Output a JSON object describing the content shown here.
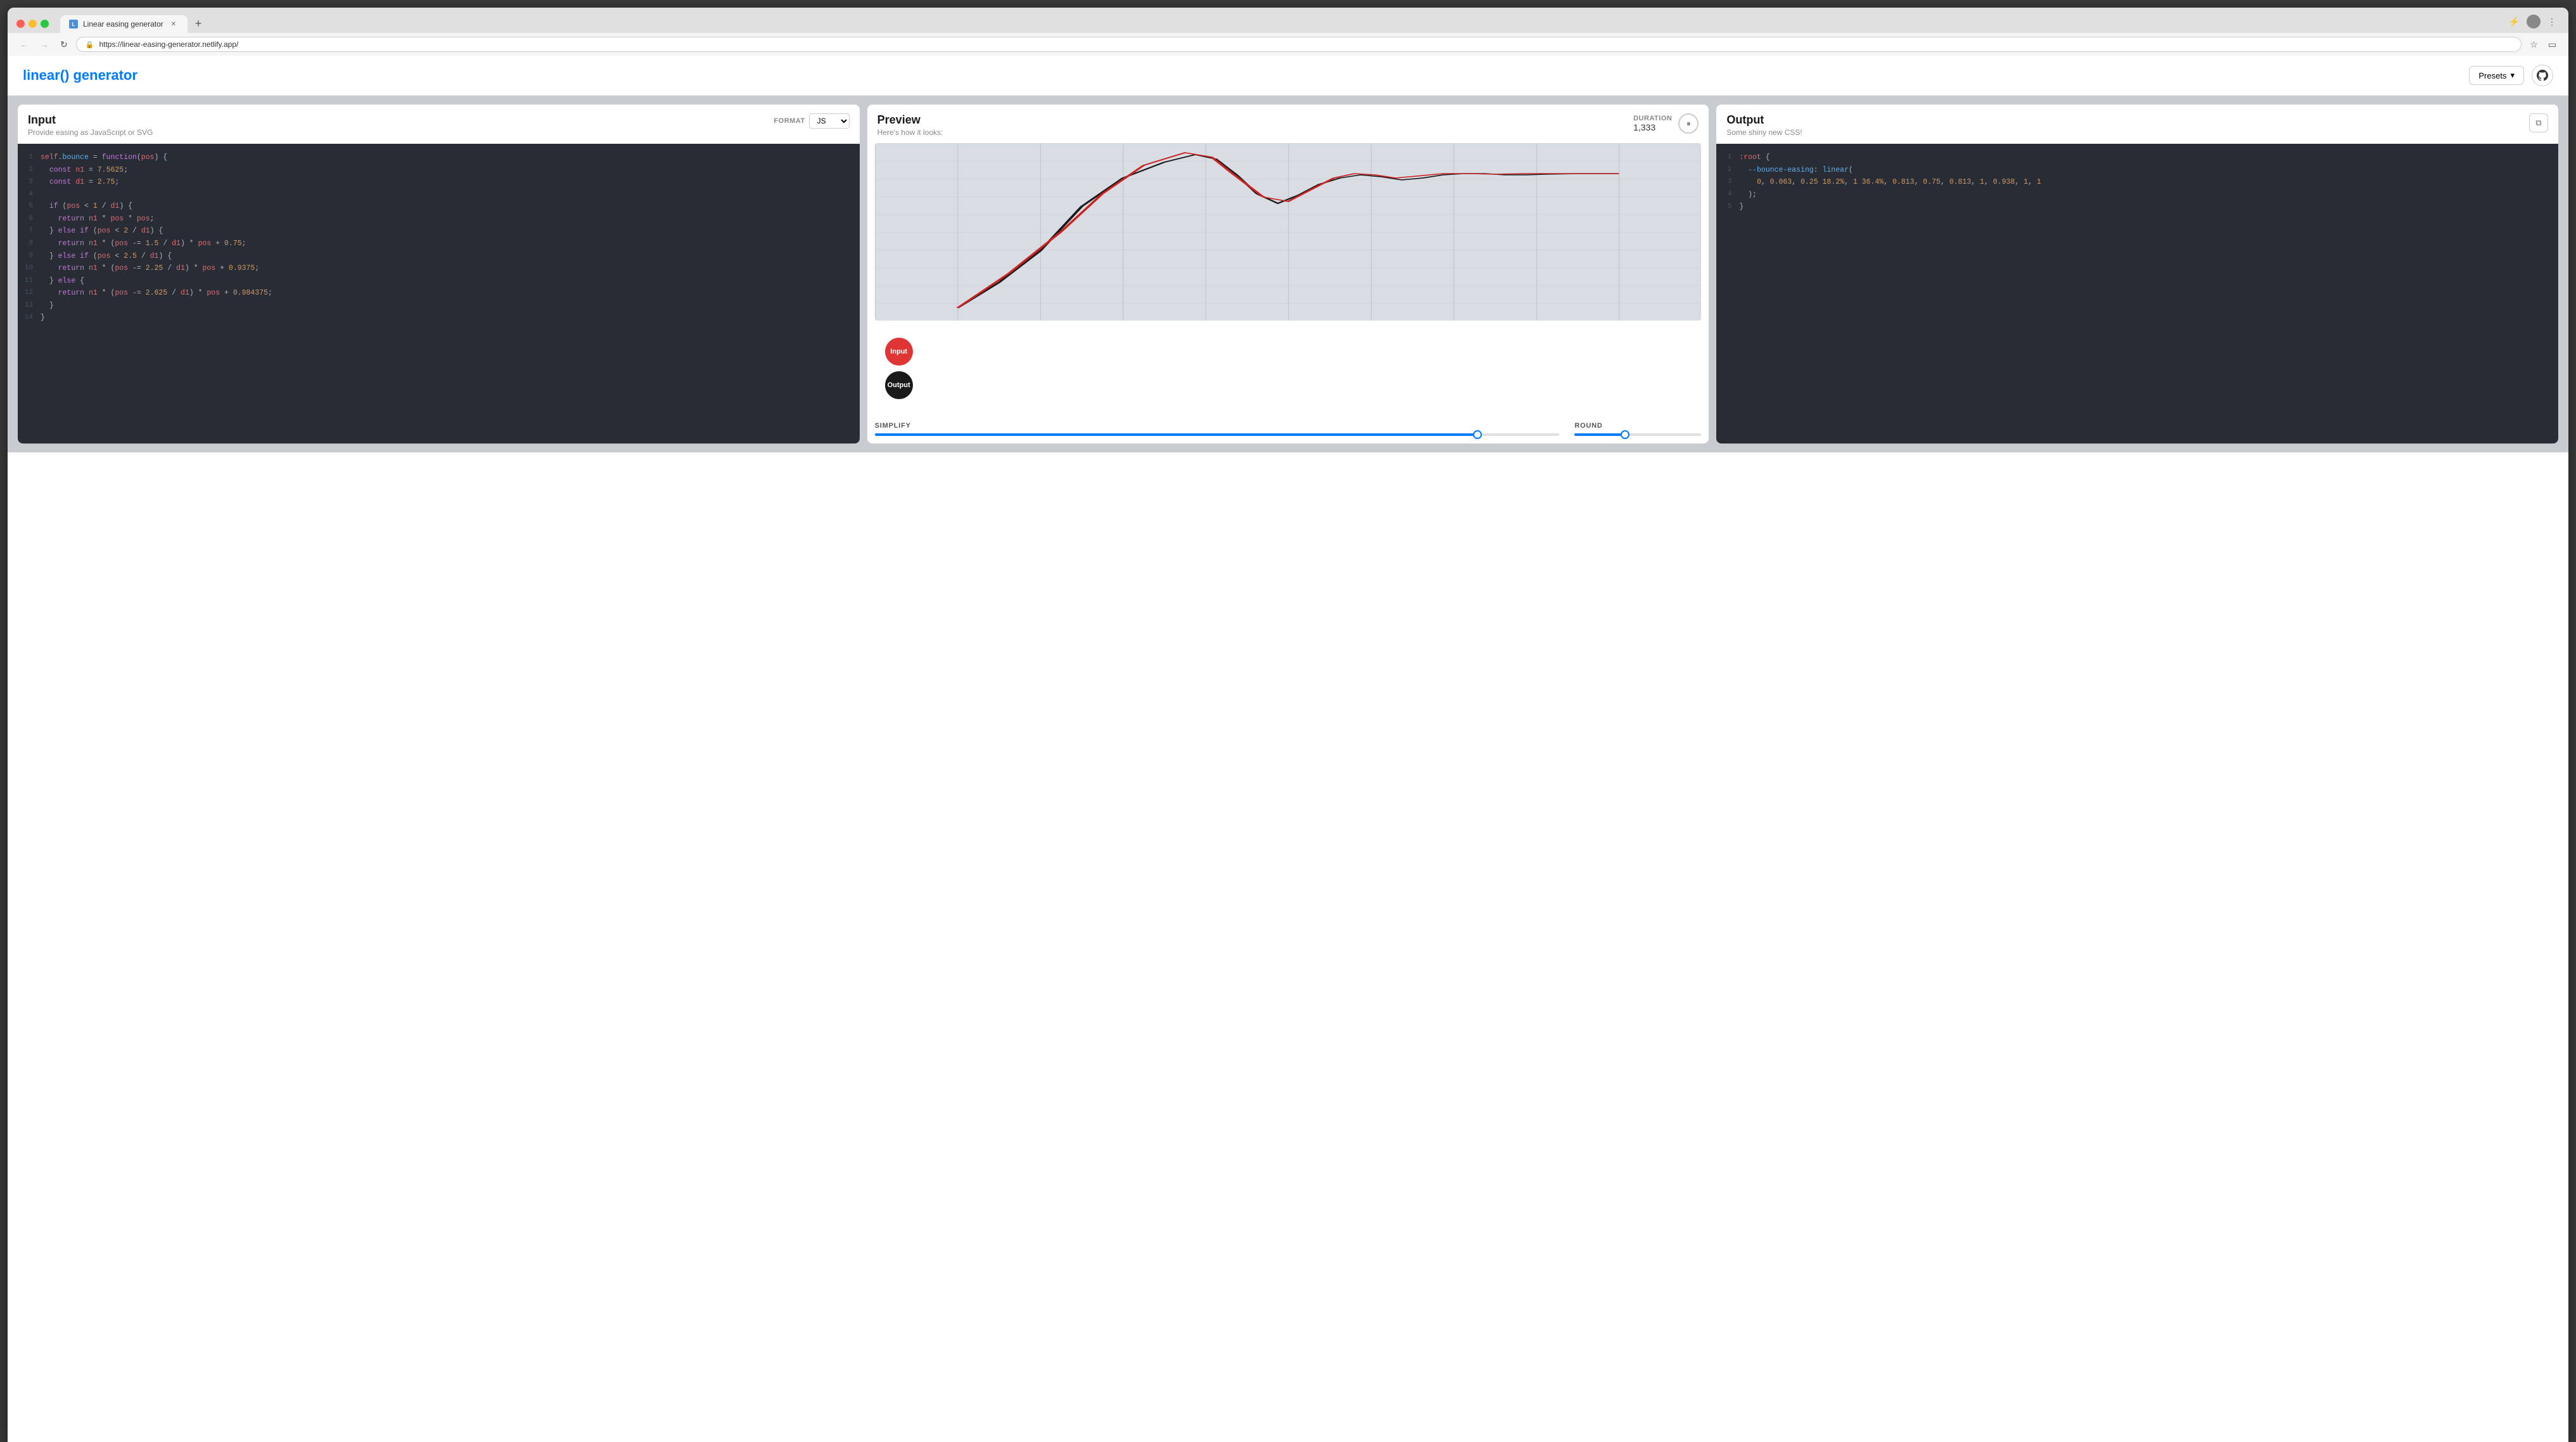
{
  "browser": {
    "url": "https://linear-easing-generator.netlify.app/",
    "tab_title": "Linear easing generator",
    "tab_favicon": "L"
  },
  "header": {
    "logo": "linear() generator",
    "presets_label": "Presets",
    "github_icon": "⬡"
  },
  "input_panel": {
    "title": "Input",
    "subtitle": "Provide easing as JavaScript or SVG",
    "format_label": "FORMAT",
    "format_value": "JS",
    "code_lines": [
      {
        "num": 1,
        "text": "self.bounce = function(pos) {"
      },
      {
        "num": 2,
        "text": "  const n1 = 7.5625;"
      },
      {
        "num": 3,
        "text": "  const d1 = 2.75;"
      },
      {
        "num": 4,
        "text": ""
      },
      {
        "num": 5,
        "text": "  if (pos < 1 / d1) {"
      },
      {
        "num": 6,
        "text": "    return n1 * pos * pos;"
      },
      {
        "num": 7,
        "text": "  } else if (pos < 2 / d1) {"
      },
      {
        "num": 8,
        "text": "    return n1 * (pos -= 1.5 / d1) * pos + 0.75;"
      },
      {
        "num": 9,
        "text": "  } else if (pos < 2.5 / d1) {"
      },
      {
        "num": 10,
        "text": "    return n1 * (pos -= 2.25 / d1) * pos + 0.9375;"
      },
      {
        "num": 11,
        "text": "  } else {"
      },
      {
        "num": 12,
        "text": "    return n1 * (pos -= 2.625 / d1) * pos + 0.984375;"
      },
      {
        "num": 13,
        "text": "  }"
      },
      {
        "num": 14,
        "text": "}"
      }
    ]
  },
  "preview_panel": {
    "title": "Preview",
    "subtitle": "Here's how it looks:",
    "duration_label": "DURATION",
    "duration_value": "1,333",
    "play_icon": "⏸",
    "input_ball_label": "Input",
    "output_ball_label": "Output",
    "simplify_label": "SIMPLIFY",
    "simplify_percent": 88,
    "round_label": "ROUND",
    "round_percent": 40
  },
  "output_panel": {
    "title": "Output",
    "subtitle": "Some shiny new CSS!",
    "copy_icon": "⧉",
    "code_lines": [
      {
        "num": 1,
        "text": ":root {"
      },
      {
        "num": 2,
        "text": "  --bounce-easing: linear("
      },
      {
        "num": 3,
        "text": "    0, 0.063, 0.25 18.2%, 1 36.4%, 0.813, 0.75, 0.813, 1, 0.938, 1, 1"
      },
      {
        "num": 4,
        "text": "  );"
      },
      {
        "num": 5,
        "text": "}"
      }
    ]
  }
}
